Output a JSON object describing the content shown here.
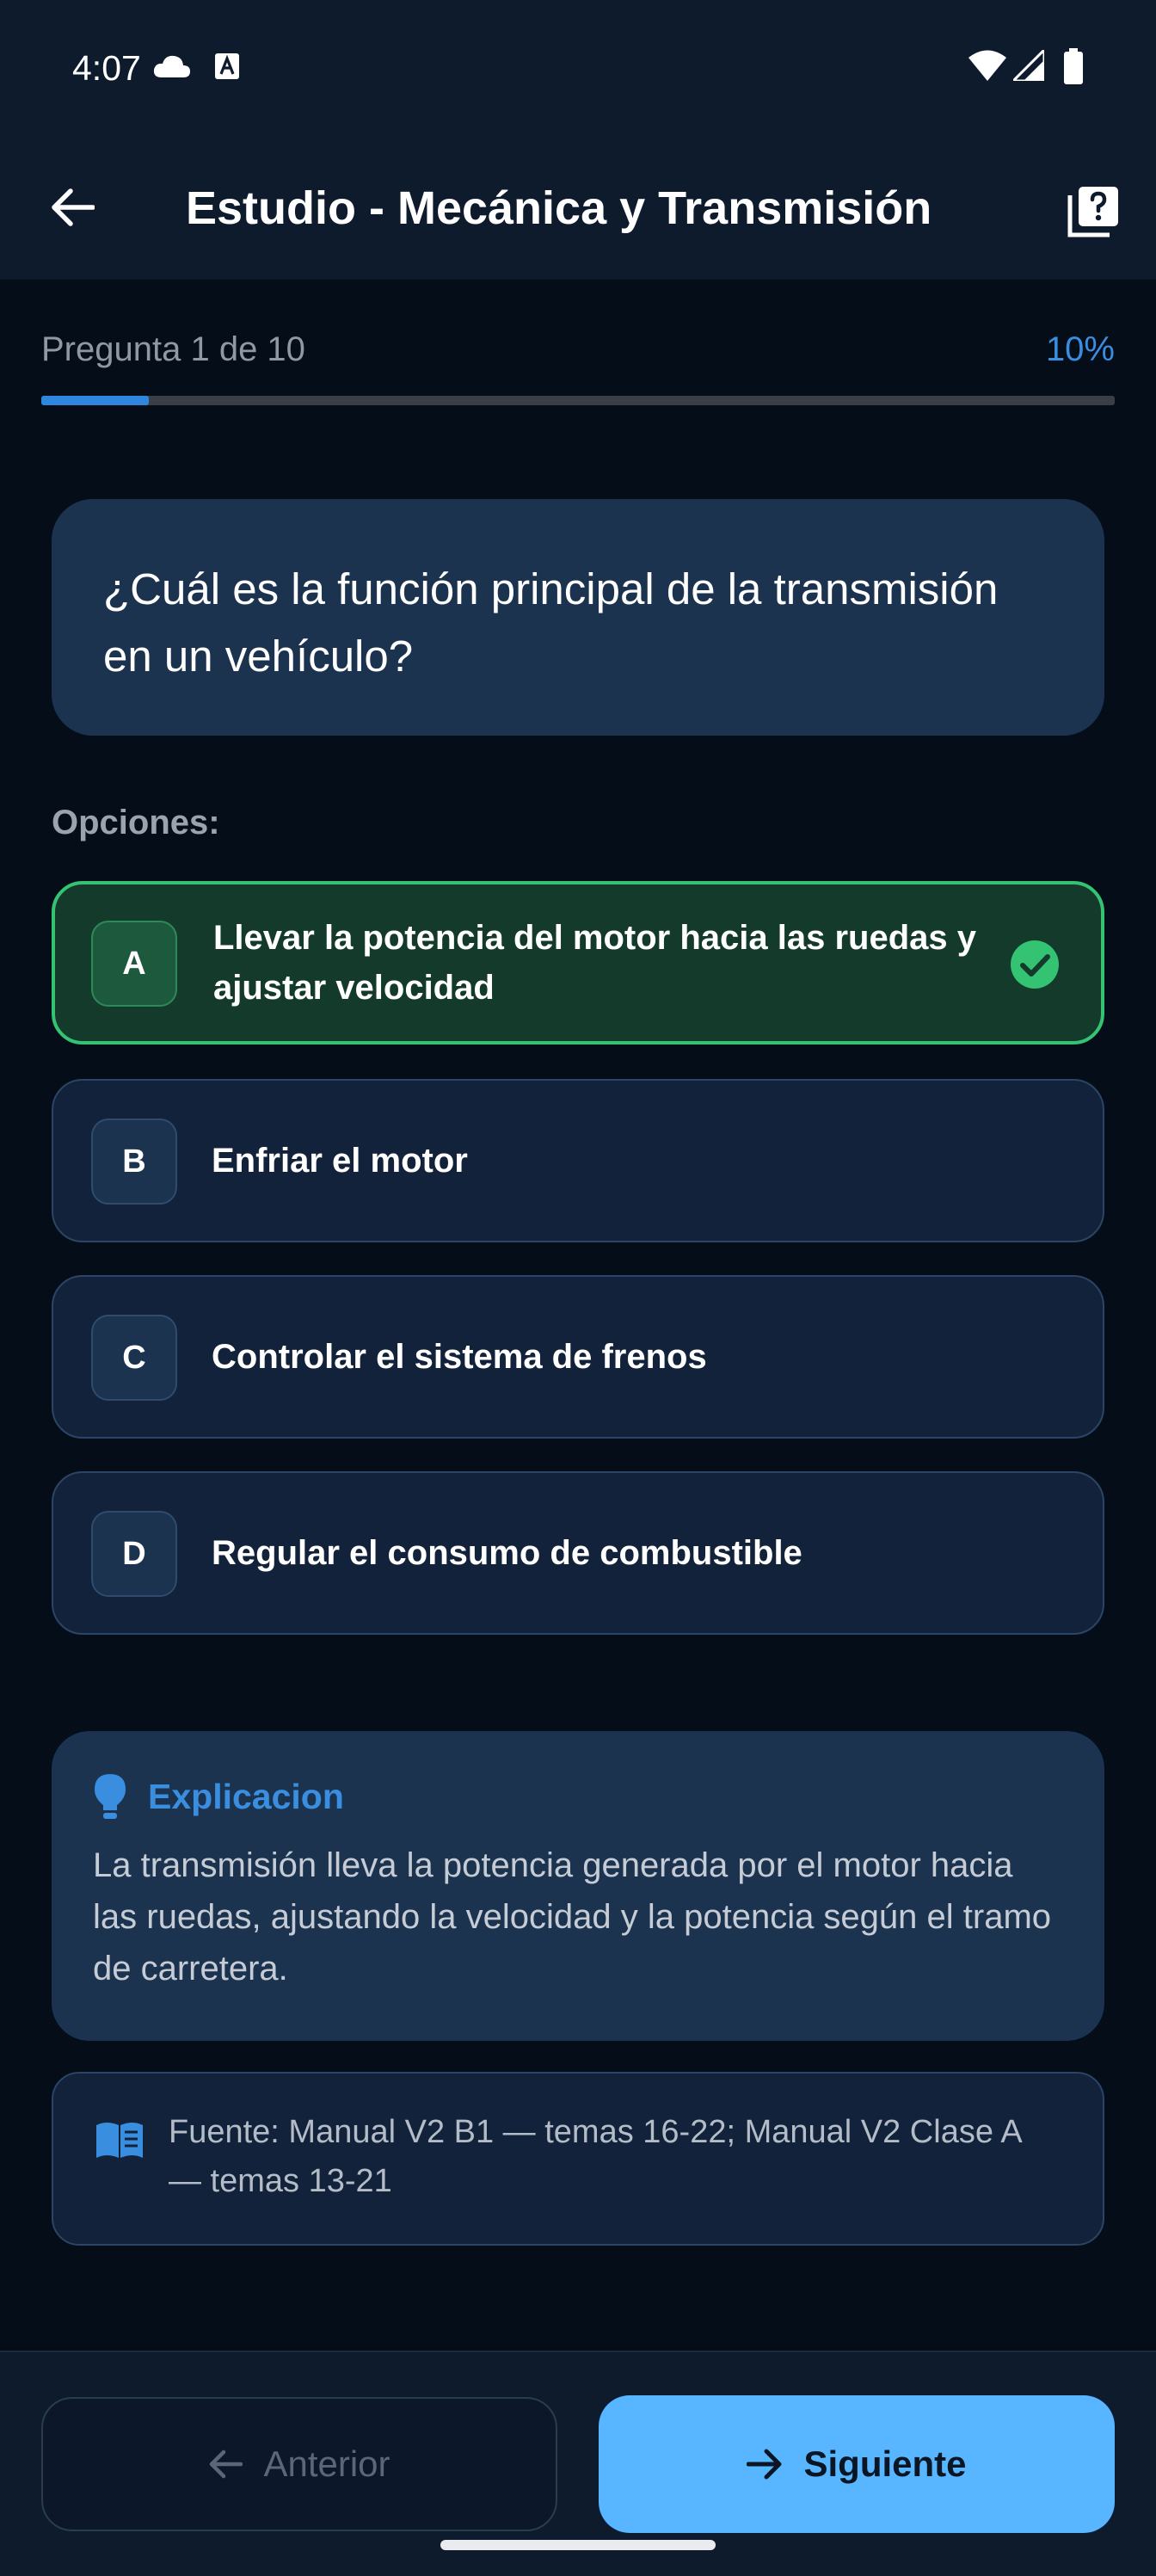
{
  "status_bar": {
    "time": "4:07"
  },
  "app_bar": {
    "title": "Estudio - Mecánica y Transmisión"
  },
  "progress": {
    "label": "Pregunta 1 de 10",
    "percent_label": "10%",
    "value": 0.1
  },
  "question": {
    "text": "¿Cuál es la función principal de la transmisión en un vehículo?"
  },
  "options_label": "Opciones:",
  "options": [
    {
      "letter": "A",
      "text": "Llevar la potencia del motor hacia las ruedas y ajustar velocidad",
      "correct": true
    },
    {
      "letter": "B",
      "text": "Enfriar el motor",
      "correct": false
    },
    {
      "letter": "C",
      "text": "Controlar el sistema de frenos",
      "correct": false
    },
    {
      "letter": "D",
      "text": "Regular el consumo de combustible",
      "correct": false
    }
  ],
  "explanation": {
    "title": "Explicacion",
    "body": "La transmisión lleva la potencia generada por el motor hacia las ruedas, ajustando la velocidad y la potencia según el tramo de carretera."
  },
  "source": {
    "text": "Fuente: Manual V2 B1 — temas 16-22; Manual V2 Clase A — temas 13-21"
  },
  "nav": {
    "prev_label": "Anterior",
    "next_label": "Siguiente"
  },
  "colors": {
    "accent": "#3a8ee0",
    "correct": "#34c273",
    "primary_button": "#57b6ff"
  },
  "icons": [
    "cloud-icon",
    "a-badge-icon",
    "wifi-icon",
    "signal-icon",
    "battery-icon",
    "back-arrow-icon",
    "help-book-icon",
    "check-circle-icon",
    "lightbulb-icon",
    "book-open-icon",
    "arrow-left-icon",
    "arrow-right-icon"
  ]
}
